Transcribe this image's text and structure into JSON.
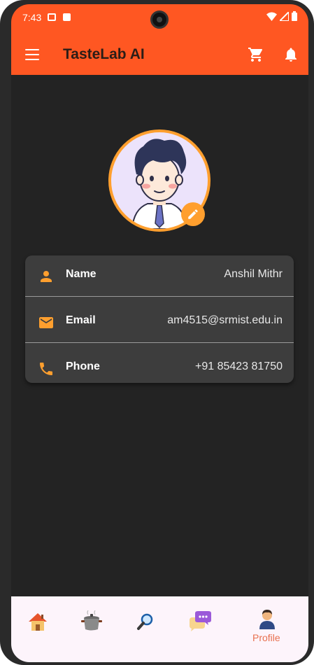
{
  "status_bar": {
    "time": "7:43"
  },
  "app_bar": {
    "title": "TasteLab AI"
  },
  "profile": {
    "rows": [
      {
        "label": "Name",
        "value": "Anshil Mithr"
      },
      {
        "label": "Email",
        "value": "am4515@srmist.edu.in"
      },
      {
        "label": "Phone",
        "value": "+91 85423 81750"
      }
    ]
  },
  "bottom_nav": {
    "items": [
      {
        "icon": "home-icon"
      },
      {
        "icon": "cooking-pot-icon"
      },
      {
        "icon": "magnifier-icon"
      },
      {
        "icon": "chat-bubbles-icon"
      },
      {
        "icon": "profile-icon",
        "label": "Profile"
      }
    ]
  },
  "colors": {
    "primary": "#ff5722",
    "accent": "#ff9f2e",
    "background": "#232323",
    "card": "#3d3d3d",
    "nav_background": "#fdf4fb",
    "nav_active": "#e8704f"
  }
}
